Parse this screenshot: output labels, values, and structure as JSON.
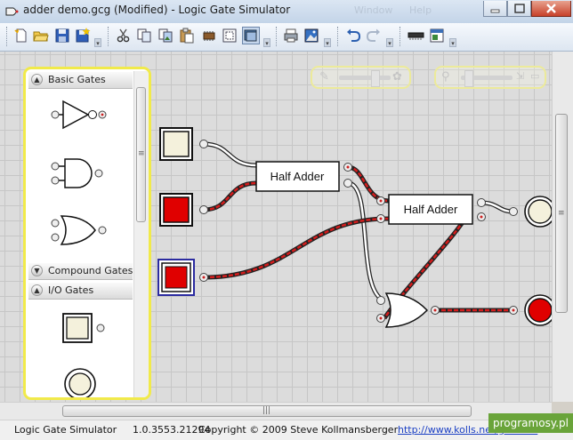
{
  "window": {
    "title": "adder demo.gcg (Modified)  - Logic Gate Simulator",
    "hidden_menus": [
      "Window",
      "Help"
    ]
  },
  "toolbar": {
    "buttons": [
      {
        "name": "new-document-button",
        "icon": "new-document-icon"
      },
      {
        "name": "open-folder-button",
        "icon": "folder-open-icon"
      },
      {
        "name": "save-button",
        "icon": "floppy-disk-icon"
      },
      {
        "name": "save-as-button",
        "icon": "floppy-star-icon"
      },
      {
        "name": "cut-button",
        "icon": "scissors-icon"
      },
      {
        "name": "copy-button",
        "icon": "copy-icon"
      },
      {
        "name": "copy-as-image-button",
        "icon": "copy-image-icon"
      },
      {
        "name": "paste-button",
        "icon": "paste-icon"
      },
      {
        "name": "chip-button",
        "icon": "integrated-circuit-icon"
      },
      {
        "name": "frame-button",
        "icon": "frame-icon"
      },
      {
        "name": "view-button",
        "icon": "window-icon"
      },
      {
        "name": "print-button",
        "icon": "printer-icon"
      },
      {
        "name": "export-image-button",
        "icon": "picture-icon"
      },
      {
        "name": "undo-button",
        "icon": "undo-arrow-icon"
      },
      {
        "name": "redo-button",
        "icon": "redo-arrow-icon"
      },
      {
        "name": "ic-tool-button",
        "icon": "ic-chip-icon"
      },
      {
        "name": "ic-properties-button",
        "icon": "ic-properties-icon"
      }
    ]
  },
  "toolbox": {
    "sections": {
      "basic": "Basic Gates",
      "compound": "Compound Gates",
      "io": "I/O Gates"
    },
    "items": [
      "not-gate",
      "and-gate",
      "or-gate",
      "user-input-toggle",
      "user-output-light"
    ]
  },
  "circuit": {
    "half_adder_1": "Half Adder",
    "half_adder_2": "Half Adder",
    "inputs": [
      {
        "name": "input-a",
        "state": "off",
        "color": "#f4f1dc"
      },
      {
        "name": "input-b",
        "state": "on",
        "color": "#e00000"
      },
      {
        "name": "input-c",
        "state": "on",
        "color": "#e00000"
      }
    ],
    "outputs": [
      {
        "name": "sum-output",
        "state": "off",
        "color": "#f4f1dc"
      },
      {
        "name": "carry-output",
        "state": "on",
        "color": "#e00000"
      }
    ],
    "colors": {
      "active_wire": "#cc1a1a",
      "toolbox_border": "#f1ea4a"
    }
  },
  "status": {
    "app_name": "Logic Gate Simulator",
    "version": "1.0.3553.21294",
    "copyright": "Copyright © 2009 Steve Kollmansberger",
    "url": "http://www.kolls.net/gatesim"
  },
  "watermark": "programosy.pl"
}
